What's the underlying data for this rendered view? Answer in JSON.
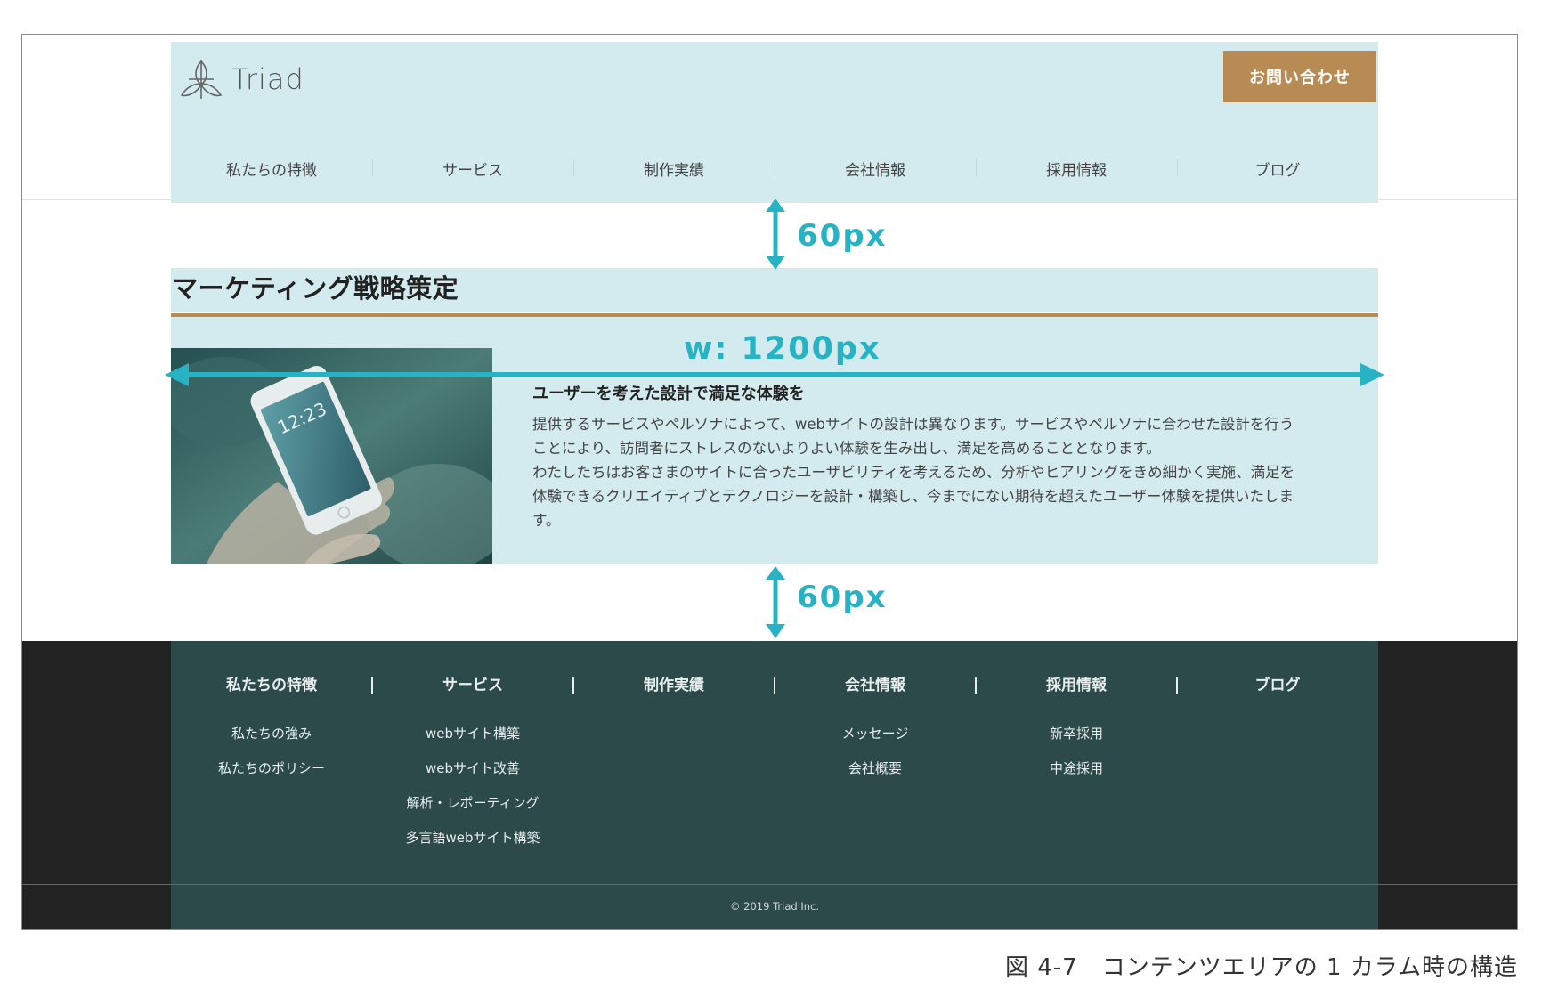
{
  "header": {
    "logo_text": "Triad",
    "contact_button": "お問い合わせ",
    "nav": [
      "私たちの特徴",
      "サービス",
      "制作実績",
      "会社情報",
      "採用情報",
      "ブログ"
    ]
  },
  "section": {
    "title": "マーケティング戦略策定",
    "sub_heading": "ユーザーを考えた設計で満足な体験を",
    "body_lines": [
      "提供するサービスやペルソナによって、webサイトの設計は異なります。サービスやペルソナに合わせた設計を行う",
      "ことにより、訪問者にストレスのないよりよい体験を生み出し、満足を高めることとなります。",
      "わたしたちはお客さまのサイトに合ったユーザビリティを考えるため、分析やヒアリングをきめ細かく実施、満足を",
      "体験できるクリエイティブとテクノロジーを設計・構築し、今までにない期待を超えたユーザー体験を提供いたしま",
      "す。"
    ],
    "phone_time": "12:23"
  },
  "annotations": {
    "top_gap": "60px",
    "width": "w: 1200px",
    "bottom_gap": "60px",
    "accent_color": "#28b3c4"
  },
  "footer": {
    "columns": [
      {
        "heading": "私たちの特徴",
        "links": [
          "私たちの強み",
          "私たちのポリシー"
        ]
      },
      {
        "heading": "サービス",
        "links": [
          "webサイト構築",
          "webサイト改善",
          "解析・レポーティング",
          "多言語webサイト構築"
        ]
      },
      {
        "heading": "制作実績",
        "links": []
      },
      {
        "heading": "会社情報",
        "links": [
          "メッセージ",
          "会社概要"
        ]
      },
      {
        "heading": "採用情報",
        "links": [
          "新卒採用",
          "中途採用"
        ]
      },
      {
        "heading": "ブログ",
        "links": []
      }
    ],
    "copyright": "© 2019 Triad Inc."
  },
  "caption": "図 4-7　コンテンツエリアの 1 カラム時の構造",
  "colors": {
    "header_bg": "#d3ebef",
    "brand": "#b88a54",
    "footer_bg": "#2c4a4a",
    "footer_outer": "#222222"
  }
}
